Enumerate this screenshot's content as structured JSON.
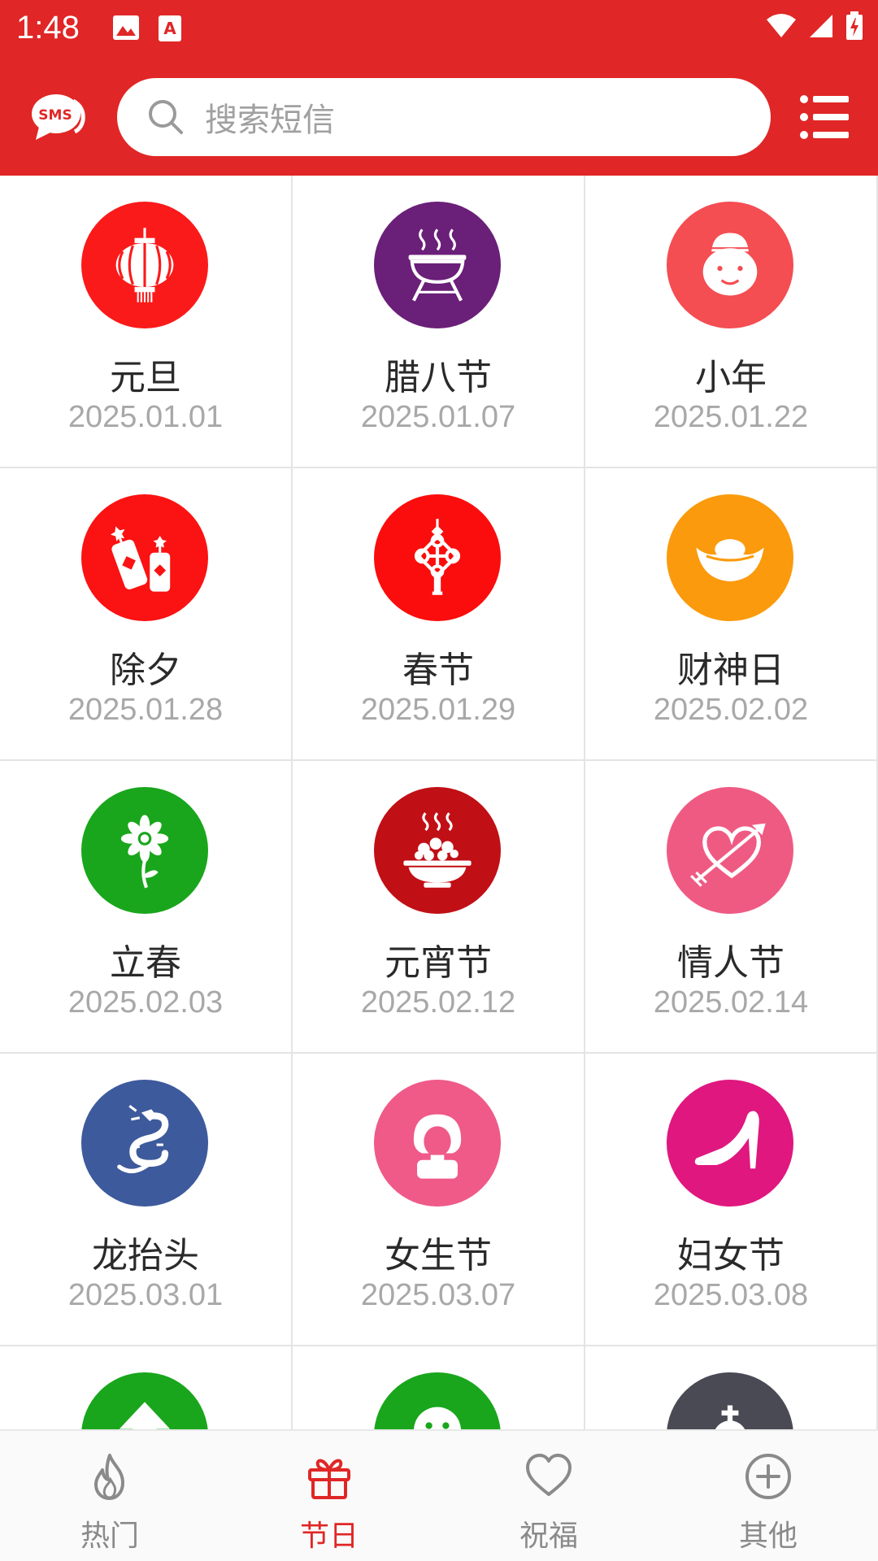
{
  "status_bar": {
    "time": "1:48"
  },
  "header": {
    "logo_text": "SMS",
    "search_placeholder": "搜索短信"
  },
  "festivals": [
    {
      "name": "元旦",
      "date": "2025.01.01",
      "color": "#fb1a1a",
      "icon": "lantern-icon"
    },
    {
      "name": "腊八节",
      "date": "2025.01.07",
      "color": "#6a1f78",
      "icon": "grill-pot-icon"
    },
    {
      "name": "小年",
      "date": "2025.01.22",
      "color": "#f44d52",
      "icon": "kitchen-god-icon"
    },
    {
      "name": "除夕",
      "date": "2025.01.28",
      "color": "#fb1212",
      "icon": "firecracker-icon"
    },
    {
      "name": "春节",
      "date": "2025.01.29",
      "color": "#fb0d0d",
      "icon": "chinese-knot-icon"
    },
    {
      "name": "财神日",
      "date": "2025.02.02",
      "color": "#fb9a0c",
      "icon": "gold-ingot-icon"
    },
    {
      "name": "立春",
      "date": "2025.02.03",
      "color": "#19a61c",
      "icon": "flower-icon"
    },
    {
      "name": "元宵节",
      "date": "2025.02.12",
      "color": "#c10f16",
      "icon": "yuanxiao-bowl-icon"
    },
    {
      "name": "情人节",
      "date": "2025.02.14",
      "color": "#ef5a83",
      "icon": "heart-arrow-icon"
    },
    {
      "name": "龙抬头",
      "date": "2025.03.01",
      "color": "#3d5a9c",
      "icon": "dragon-icon"
    },
    {
      "name": "女生节",
      "date": "2025.03.07",
      "color": "#ef5a88",
      "icon": "girl-icon"
    },
    {
      "name": "妇女节",
      "date": "2025.03.08",
      "color": "#e0177f",
      "icon": "high-heel-icon"
    },
    {
      "name": "",
      "date": "",
      "color": "#19a61c",
      "icon": "tree-icon"
    },
    {
      "name": "",
      "date": "",
      "color": "#19a61c",
      "icon": "smiley-icon"
    },
    {
      "name": "",
      "date": "",
      "color": "#4a4a54",
      "icon": "cross-cloud-icon"
    }
  ],
  "bottom_nav": [
    {
      "label": "热门",
      "icon": "flame-icon",
      "active": false
    },
    {
      "label": "节日",
      "icon": "gift-icon",
      "active": true
    },
    {
      "label": "祝福",
      "icon": "heart-icon",
      "active": false
    },
    {
      "label": "其他",
      "icon": "plus-circle-icon",
      "active": false
    }
  ],
  "colors": {
    "brand_red": "#e02626",
    "inactive_gray": "#8a8a8a"
  }
}
